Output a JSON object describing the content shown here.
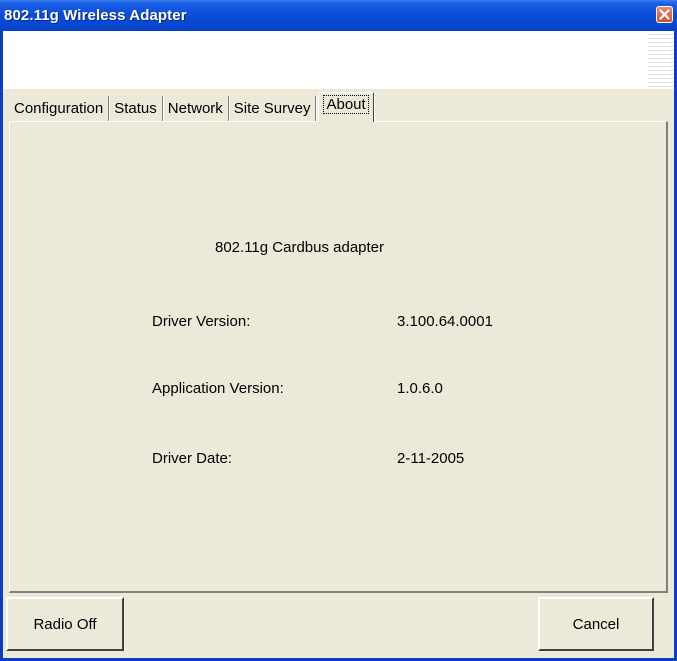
{
  "window": {
    "title": "802.11g Wireless Adapter",
    "title_bar_color": "#0a4cd8",
    "close_button_color": "#d0502a",
    "close_icon": "close-icon"
  },
  "tabs": [
    {
      "label": "Configuration",
      "active": false
    },
    {
      "label": "Status",
      "active": false
    },
    {
      "label": "Network",
      "active": false
    },
    {
      "label": "Site Survey",
      "active": false
    },
    {
      "label": "About",
      "active": true
    }
  ],
  "about": {
    "product_name": "802.11g Cardbus adapter",
    "rows": [
      {
        "label": "Driver Version:",
        "value": "3.100.64.0001"
      },
      {
        "label": "Application Version:",
        "value": "1.0.6.0"
      },
      {
        "label": "Driver Date:",
        "value": "2-11-2005"
      }
    ]
  },
  "buttons": {
    "radio_off": "Radio Off",
    "cancel": "Cancel"
  }
}
